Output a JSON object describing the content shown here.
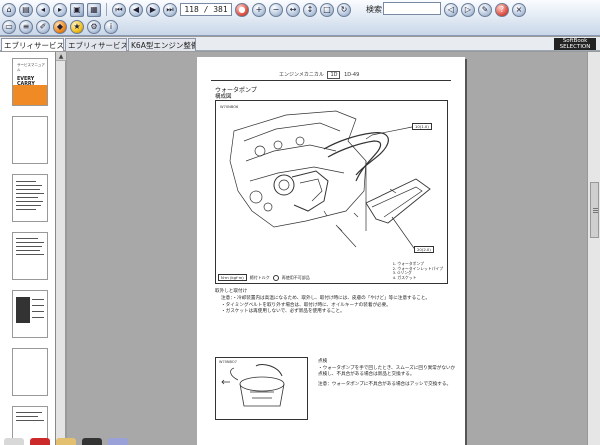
{
  "toolbar": {
    "page_display": "118 / 381",
    "search_label": "検索",
    "search_value": "",
    "row1_icons": [
      "home-icon",
      "print-icon",
      "back-icon",
      "forward-icon",
      "lock-icon",
      "save-icon",
      "first-page-icon",
      "prev-page-icon",
      "next-page-icon",
      "last-page-icon",
      "bookmark-icon",
      "zoom-in-icon",
      "zoom-out-icon",
      "fit-width-icon",
      "fit-page-icon",
      "actual-size-icon",
      "rotate-icon",
      "search-prev-icon",
      "search-next-icon",
      "highlight-icon",
      "help-icon"
    ],
    "row2_icons": [
      "open-icon",
      "bookmark-list-icon",
      "note-icon",
      "memo-icon",
      "history-icon",
      "settings-icon",
      "info-icon"
    ]
  },
  "tabs": [
    {
      "label": "エブリィサービスマ",
      "active": true
    },
    {
      "label": "エブリィサービスマ",
      "active": false
    },
    {
      "label": "K6A型エンジン整備",
      "active": false
    }
  ],
  "brand": {
    "line1": "SoftBook",
    "line2": "SELECTION"
  },
  "thumbnails": {
    "cover_top": "サービスマニュアル",
    "cover_title": "EVERY\nCARRY"
  },
  "page": {
    "header_text": "エンジンメカニカル",
    "header_code": "1D",
    "header_page": "1D-49",
    "section_title": "ウォータポンプ",
    "section_subtitle": "構成図",
    "figure": {
      "code": "W70NBO6",
      "callout_top": "10(1.0)",
      "callout_bottom": "20(2.0)",
      "torque_box": "N·m (kgf·m)",
      "torque_label": "締付トルク",
      "no_reuse_label": "再使用不可部品",
      "legend": [
        "1. ウォータポンプ",
        "2. ウォータインレットパイプ",
        "3. Oリング",
        "4. ガスケット"
      ]
    },
    "body_heading": "取外しと取付け",
    "body_lines": [
      "注意：・冷却装置内は高温になるため、取外し、取付け時には、皮膚の「やけど」等に注意すること。",
      "・タイミングベルトを取り外す場合は、取付け時に、オイルキーナの装着が必要。",
      "・ガスケットは再使用しないで、必ず新品を使用すること。"
    ],
    "fig2_code": "W70NBO7",
    "side_heading": "点検",
    "side_lines": [
      "・ウォータポンプを手で回したとき、スムーズに回り異常がないか点検し、不具合がある場合は新品と交換する。",
      "注意：ウォータポンプに不具合がある場合はアッシで交換する。"
    ]
  }
}
